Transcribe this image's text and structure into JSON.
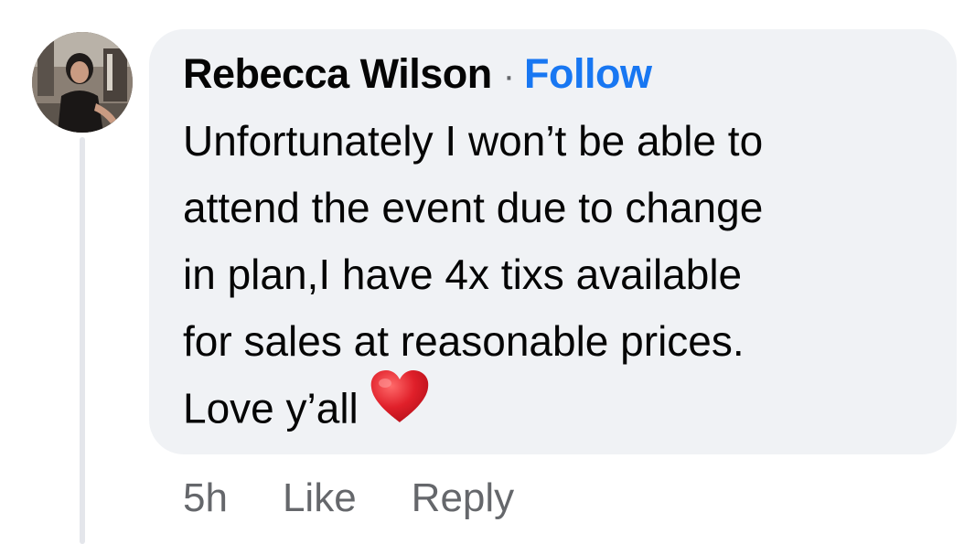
{
  "comment": {
    "author": "Rebecca Wilson",
    "separator": "·",
    "follow_label": "Follow",
    "text_lines": [
      "Unfortunately I won’t be able to",
      "attend the event due to change",
      "in plan,I have 4x tixs available",
      "for sales at reasonable prices.",
      "Love y’all"
    ],
    "emoji": "red-heart-emoji"
  },
  "actions": {
    "timestamp": "5h",
    "like_label": "Like",
    "reply_label": "Reply"
  },
  "colors": {
    "bubble_bg": "#f0f2f5",
    "link_blue": "#1877f2",
    "muted_gray": "#65676b",
    "text_dark": "#050505",
    "heart_red": "#e0202a"
  }
}
